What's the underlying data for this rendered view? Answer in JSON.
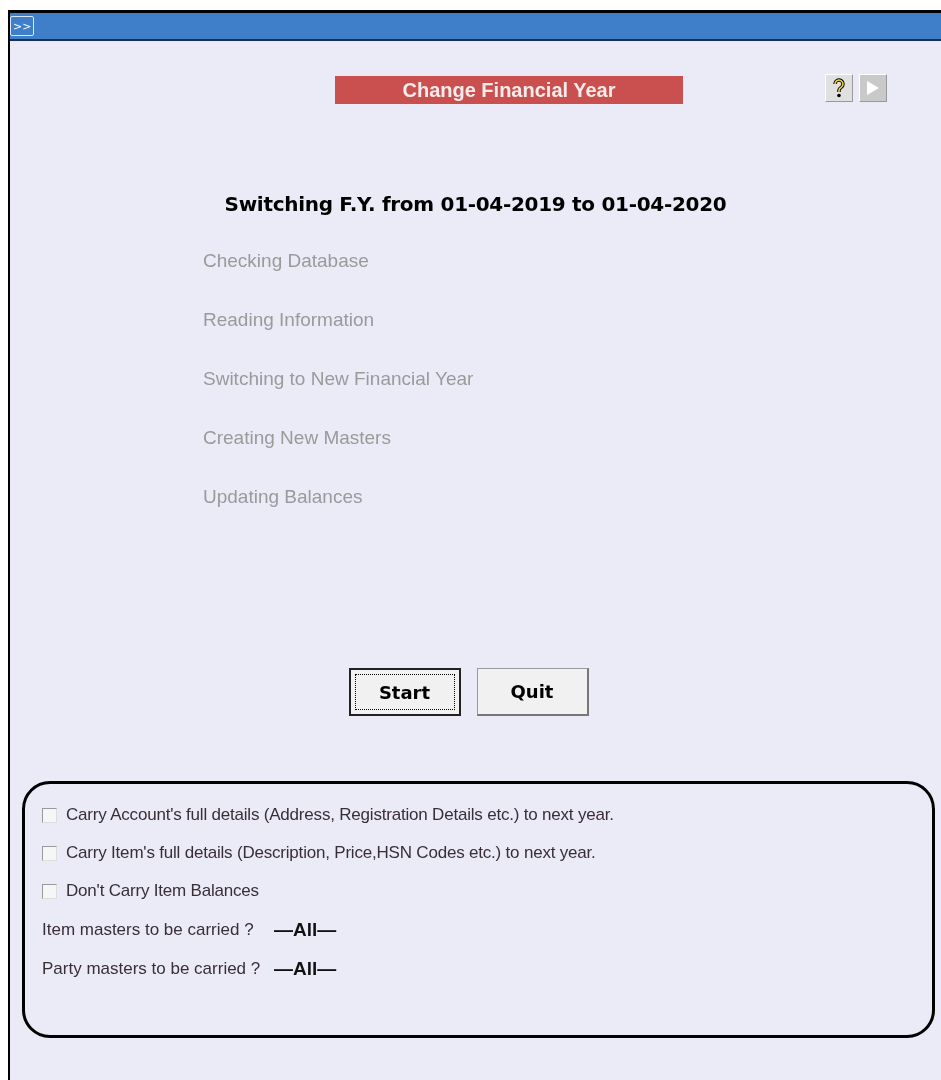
{
  "header": {
    "expand_button": ">>"
  },
  "title": "Change Financial Year",
  "heading": "Switching F.Y. from 01-04-2019 to 01-04-2020",
  "steps": [
    "Checking Database",
    "Reading Information",
    "Switching to New Financial Year",
    "Creating New Masters",
    "Updating Balances"
  ],
  "buttons": [
    {
      "label": "Start",
      "focused": true
    },
    {
      "label": "Quit",
      "focused": false
    }
  ],
  "options": [
    {
      "label": "Carry Account's full details (Address, Registration Details etc.) to next year.",
      "checked": false
    },
    {
      "label": "Carry Item's full details (Description, Price,HSN Codes etc.) to next year.",
      "checked": false
    },
    {
      "label": "Don't Carry Item Balances",
      "checked": false
    }
  ],
  "masters": [
    {
      "label": "Item masters to be carried ?",
      "value": "—All—"
    },
    {
      "label": "Party masters to be carried ?",
      "value": "—All—"
    }
  ]
}
